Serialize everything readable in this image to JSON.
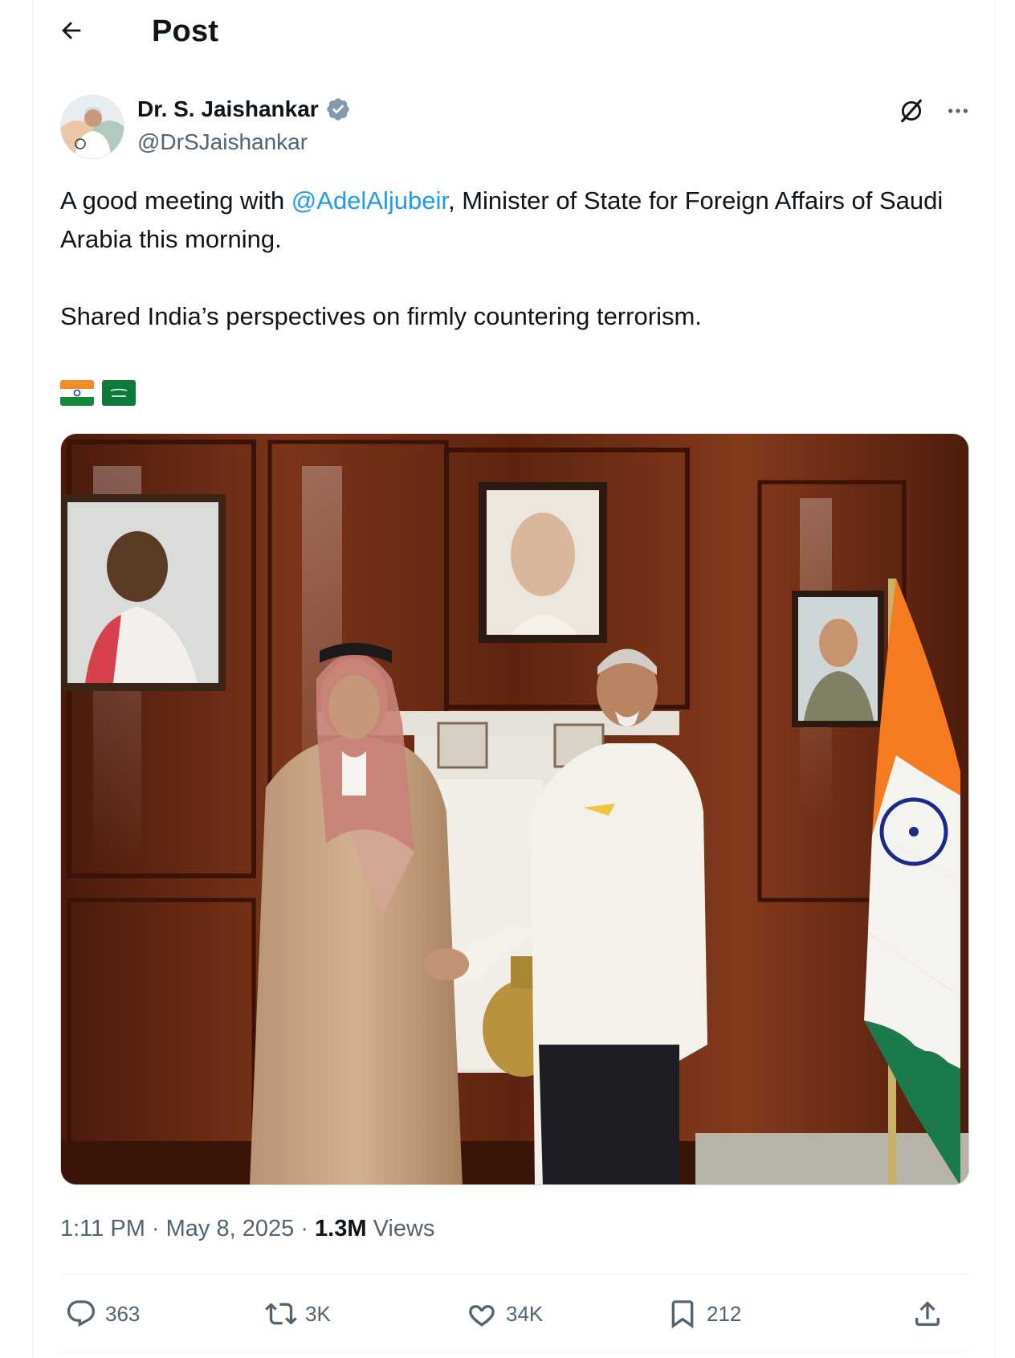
{
  "header": {
    "title": "Post"
  },
  "author": {
    "name": "Dr. S. Jaishankar",
    "handle": "@DrSJaishankar"
  },
  "post": {
    "text_before_mention": "A good meeting with ",
    "mention": "@AdelAljubeir",
    "text_after_mention": ", Minister of State for Foreign Affairs of Saudi Arabia this morning.",
    "paragraph2": "Shared India’s perspectives on firmly countering terrorism.",
    "flags": [
      "india-flag",
      "saudi-flag"
    ]
  },
  "meta": {
    "time": "1:11 PM",
    "date": "May 8, 2025",
    "views_count": "1.3M",
    "views_label": "Views"
  },
  "actions": {
    "replies": "363",
    "reposts": "3K",
    "likes": "34K",
    "bookmarks": "212"
  },
  "icons": {
    "back": "arrow-left-icon",
    "verified": "verified-badge-icon",
    "grok": "grok-icon",
    "more": "more-icon",
    "reply": "reply-icon",
    "repost": "repost-icon",
    "like": "heart-icon",
    "bookmark": "bookmark-icon",
    "share": "share-icon"
  },
  "colors": {
    "text": "#0f1419",
    "secondary": "#536471",
    "link": "#1d9bf0",
    "divider": "#eff3f4"
  }
}
